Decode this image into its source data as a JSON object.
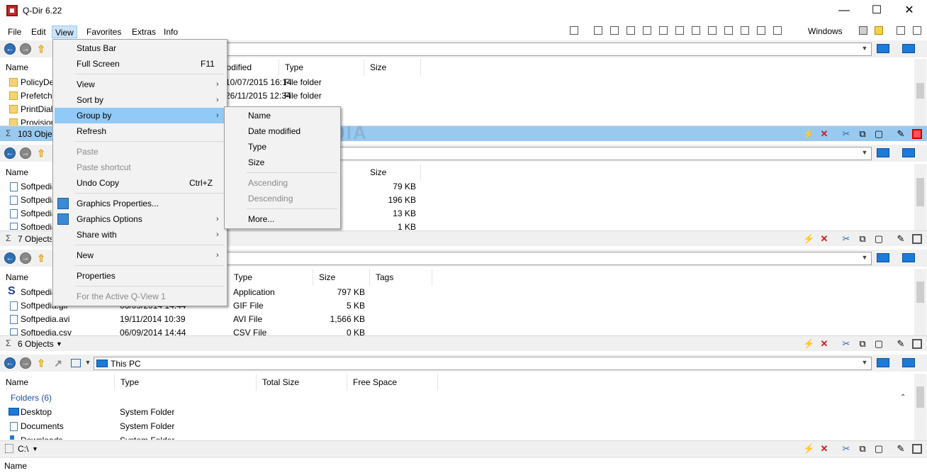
{
  "window": {
    "title": "Q-Dir 6.22",
    "minimize_glyph": "—",
    "maximize_glyph": "☐",
    "close_glyph": "✕"
  },
  "menubar": {
    "items": [
      "File",
      "Edit",
      "View",
      "Favorites",
      "Extras",
      "Info"
    ],
    "windows_label": "Windows"
  },
  "pane1": {
    "columns": [
      "Name",
      "Date modified",
      "Type",
      "Size"
    ],
    "rows": [
      {
        "name": "PolicyDefinitions",
        "date": "10/07/2015 16:14",
        "type": "File folder"
      },
      {
        "name": "Prefetch",
        "date": "26/11/2015 12:34",
        "type": "File folder"
      },
      {
        "name": "PrintDialog",
        "date": "",
        "type": ""
      },
      {
        "name": "Provisioning",
        "date": "",
        "type": ""
      }
    ],
    "status": "103 Objects"
  },
  "pane2": {
    "columns": [
      "Name",
      "Size"
    ],
    "rows": [
      {
        "name": "Softpedia",
        "size": "79 KB"
      },
      {
        "name": "Softpedia",
        "size": "196 KB"
      },
      {
        "name": "Softpedia",
        "size": "13 KB"
      },
      {
        "name": "Softpedia",
        "size": "1 KB"
      }
    ],
    "status": "7 Objects"
  },
  "pane3": {
    "columns": [
      "Name",
      "Type",
      "Size",
      "Tags"
    ],
    "rows": [
      {
        "name": "Softpedia",
        "date": "",
        "type": "Application",
        "size": "797 KB"
      },
      {
        "name": "Softpedia.gif",
        "date": "06/09/2014 14:44",
        "type": "GIF File",
        "size": "5 KB"
      },
      {
        "name": "Softpedia.avi",
        "date": "19/11/2014 10:39",
        "type": "AVI File",
        "size": "1,566 KB"
      },
      {
        "name": "Softpedia.csv",
        "date": "06/09/2014 14:44",
        "type": "CSV File",
        "size": "0 KB"
      }
    ],
    "status": "6 Objects"
  },
  "pane4": {
    "address": "This PC",
    "columns": [
      "Name",
      "Type",
      "Total Size",
      "Free Space"
    ],
    "group_header": "Folders (6)",
    "rows": [
      {
        "name": "Desktop",
        "type": "System Folder"
      },
      {
        "name": "Documents",
        "type": "System Folder"
      },
      {
        "name": "Downloads",
        "type": "System Folder"
      }
    ],
    "status": "C:\\"
  },
  "bottom_header": "Name",
  "view_menu": {
    "items": [
      {
        "label": "Status Bar",
        "shortcut": ""
      },
      {
        "label": "Full Screen",
        "shortcut": "F11"
      },
      {
        "label": "View",
        "shortcut": ""
      },
      {
        "label": "Sort by",
        "shortcut": ""
      },
      {
        "label": "Group by",
        "shortcut": ""
      },
      {
        "label": "Refresh",
        "shortcut": ""
      },
      {
        "label": "Paste",
        "shortcut": ""
      },
      {
        "label": "Paste shortcut",
        "shortcut": ""
      },
      {
        "label": "Undo Copy",
        "shortcut": "Ctrl+Z"
      },
      {
        "label": "Graphics Properties...",
        "shortcut": ""
      },
      {
        "label": "Graphics Options",
        "shortcut": ""
      },
      {
        "label": "Share with",
        "shortcut": ""
      },
      {
        "label": "New",
        "shortcut": ""
      },
      {
        "label": "Properties",
        "shortcut": ""
      },
      {
        "label": "For the Active Q-View 1",
        "shortcut": ""
      }
    ]
  },
  "groupby_menu": {
    "items": [
      "Name",
      "Date modified",
      "Type",
      "Size",
      "Ascending",
      "Descending",
      "More..."
    ]
  },
  "watermark": "SOFTPEDIA",
  "colors": {
    "accent": "#91c9f7",
    "active_status": "#99c9ef",
    "red": "#d21a1a"
  }
}
